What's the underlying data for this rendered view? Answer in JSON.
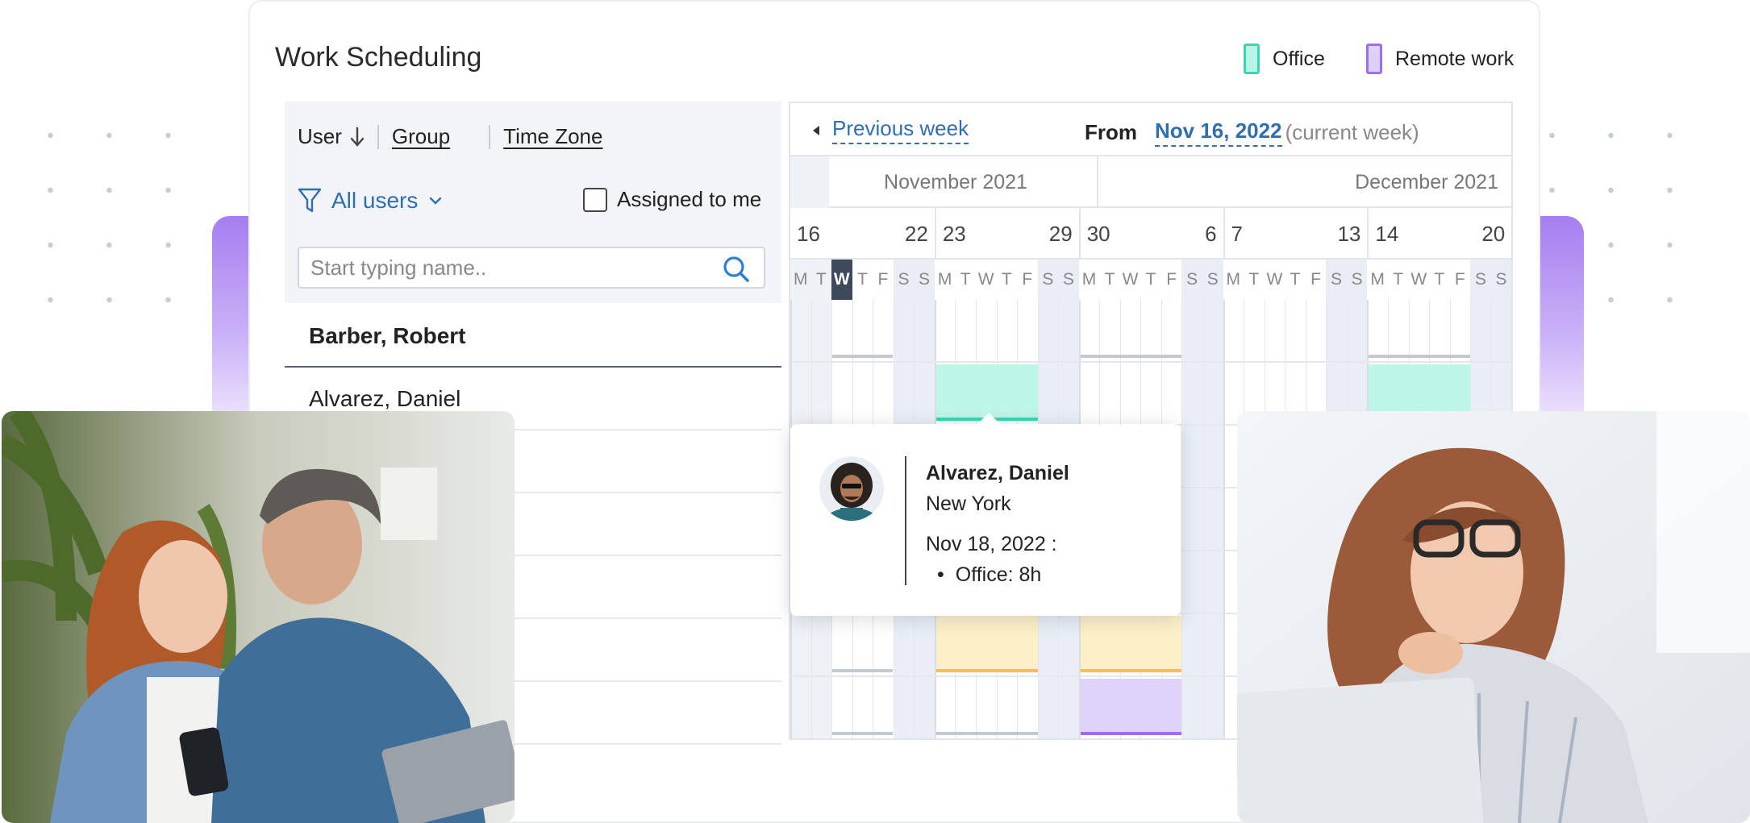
{
  "app": {
    "title": "Work Scheduling"
  },
  "legend": [
    {
      "label": "Office",
      "fill": "#b8f5e6",
      "border": "#3ad6b0"
    },
    {
      "label": "Remote work",
      "fill": "#ddd0fb",
      "border": "#9a70ee"
    }
  ],
  "sort_bar": {
    "user": "User",
    "group": "Group",
    "time_zone": "Time Zone"
  },
  "filter": {
    "label": "All users",
    "assigned_label": "Assigned to me"
  },
  "search": {
    "placeholder": "Start typing name.."
  },
  "users": [
    {
      "name": "Barber, Robert"
    },
    {
      "name": "Alvarez, Daniel"
    }
  ],
  "calendar_nav": {
    "previous_week": "Previous week",
    "from_label": "From",
    "from_date": "Nov 16, 2022",
    "current_week": "(current week)"
  },
  "months": [
    "November 2021",
    "December 2021"
  ],
  "week_ranges": [
    {
      "start": "16",
      "end": "22"
    },
    {
      "start": "23",
      "end": "29"
    },
    {
      "start": "30",
      "end": "6"
    },
    {
      "start": "7",
      "end": "13"
    },
    {
      "start": "14",
      "end": "20"
    }
  ],
  "weekday_letters": [
    "M",
    "T",
    "W",
    "T",
    "F",
    "S",
    "S"
  ],
  "today_weekday": "W",
  "tooltip": {
    "name": "Alvarez, Daniel",
    "location": "New York",
    "date": "Nov 18, 2022 :",
    "bullet": "•",
    "detail": "Office: 8h"
  },
  "colors": {
    "accent": "#2f6fb0",
    "office": "#b8f5e6",
    "remote": "#ddd0fb",
    "yellow": "#fdefc4",
    "yellow_bar": "#f5c33b",
    "weekend": "#e9eef6",
    "today": "#3c4a5c"
  }
}
